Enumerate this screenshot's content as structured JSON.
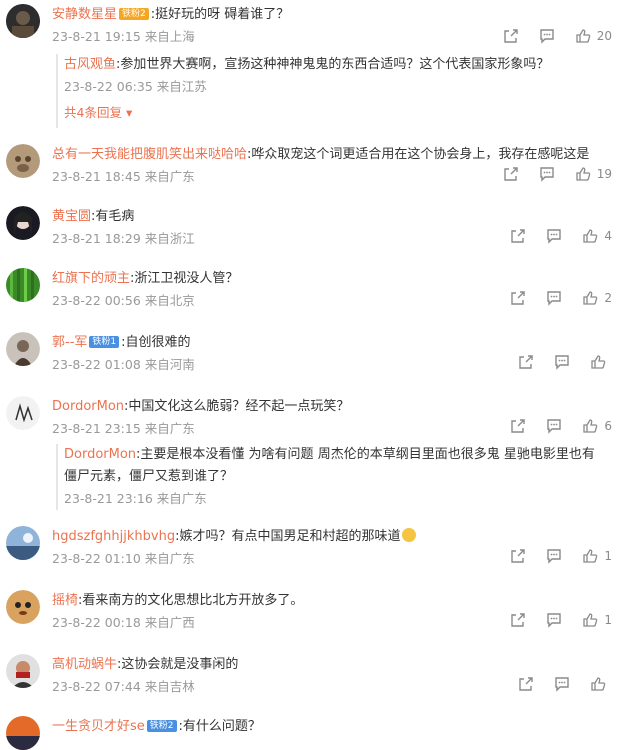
{
  "comments": [
    {
      "user": "安静数星星",
      "badge": "铁粉2",
      "text": ":挺好玩的呀 碍着谁了？",
      "date": "23-8-21 19:15",
      "location": "来自上海",
      "likes": "20",
      "reply": {
        "user": "古风观鱼",
        "text": ":参加世界大赛啊，宣扬这种神神鬼鬼的东西合适吗？这个代表国家形象吗？",
        "date": "23-8-22 06:35",
        "location": "来自江苏"
      },
      "more": "共4条回复"
    },
    {
      "user": "总有一天我能把腹肌笑出来哒哈哈",
      "text": ":哗众取宠这个词更适合用在这个协会身上，我存在感呢这是",
      "date": "23-8-21 18:45",
      "location": "来自广东",
      "likes": "19"
    },
    {
      "user": "黄宝圆",
      "text": ":有毛病",
      "date": "23-8-21 18:29",
      "location": "来自浙江",
      "likes": "4"
    },
    {
      "user": "红旗下的顽主",
      "text": ":浙江卫视没人管？",
      "date": "23-8-22 00:56",
      "location": "来自北京",
      "likes": "2"
    },
    {
      "user": "郭--军",
      "badge": "铁粉1",
      "text": ":自创很难的",
      "date": "23-8-22 01:08",
      "location": "来自河南",
      "likes": ""
    },
    {
      "user": "DordorMon",
      "text": ":中国文化这么脆弱？经不起一点玩笑？",
      "date": "23-8-21 23:15",
      "location": "来自广东",
      "likes": "6",
      "reply": {
        "user": "DordorMon",
        "text": ":主要是根本没看懂 为啥有问题 周杰伦的本草纲目里面也很多鬼 星驰电影里也有僵尸元素，僵尸又惹到谁了？",
        "date": "23-8-21 23:16",
        "location": "来自广东"
      }
    },
    {
      "user": "hgdszfghhjjkhbvhg",
      "text": ":嫉才吗？有点中国男足和村超的那味道",
      "date": "23-8-22 01:10",
      "location": "来自广东",
      "likes": "1"
    },
    {
      "user": "摇椅",
      "text": ":看来南方的文化思想比北方开放多了。",
      "date": "23-8-22 00:18",
      "location": "来自广西",
      "likes": "1"
    },
    {
      "user": "高机动蜗牛",
      "text": ":这协会就是没事闲的",
      "date": "23-8-22 07:44",
      "location": "来自吉林",
      "likes": ""
    },
    {
      "user": "一生贪贝才好se",
      "badge": "铁粉2",
      "text": ":有什么问题？",
      "date": "",
      "location": "",
      "likes": ""
    }
  ],
  "icons": {
    "share": "share-icon",
    "comment": "comment-icon",
    "like": "like-icon"
  },
  "colors": {
    "username": "#eb7350",
    "meta": "#999999",
    "badge": "#4a90e2"
  }
}
